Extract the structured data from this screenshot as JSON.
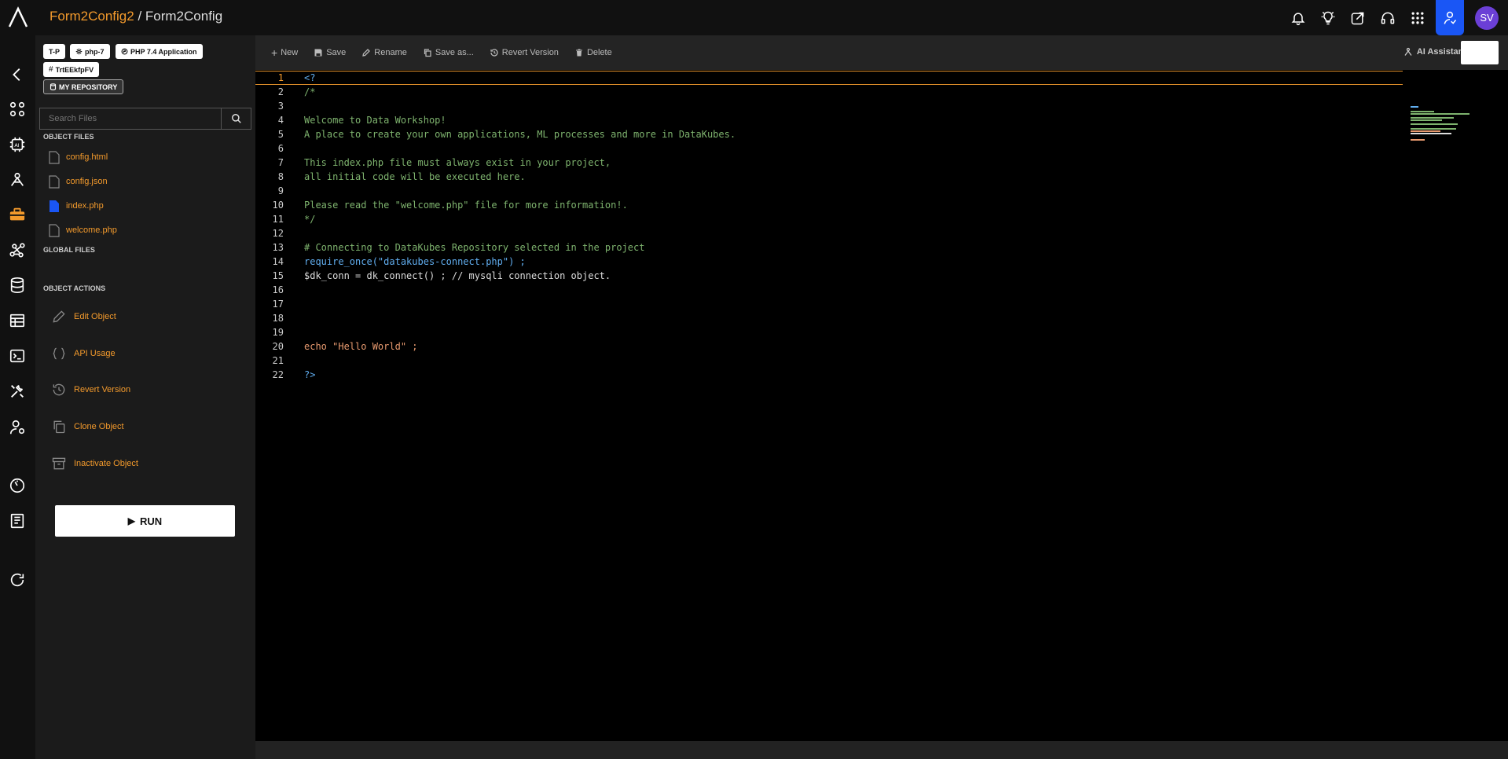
{
  "breadcrumb": {
    "parent": "Form2Config2",
    "separator": " / ",
    "current": "Form2Config"
  },
  "user": {
    "initials": "SV"
  },
  "tags": [
    {
      "label": "T-P",
      "icon": ""
    },
    {
      "label": "php-7",
      "icon": "gear-icon"
    },
    {
      "label": "PHP 7.4 Application",
      "icon": "php-icon"
    },
    {
      "label": "TrtEEkfpFV",
      "icon": "hash-icon"
    }
  ],
  "repo_tag": "MY REPOSITORY",
  "search": {
    "placeholder": "Search Files"
  },
  "sections": {
    "object_files": "OBJECT FILES",
    "global_files": "GLOBAL FILES",
    "object_actions": "OBJECT ACTIONS"
  },
  "files": [
    {
      "name": "config.html",
      "active": false
    },
    {
      "name": "config.json",
      "active": false
    },
    {
      "name": "index.php",
      "active": true
    },
    {
      "name": "welcome.php",
      "active": false
    }
  ],
  "actions": [
    {
      "label": "Edit Object",
      "icon": "pencil-icon"
    },
    {
      "label": "API Usage",
      "icon": "braces-icon"
    },
    {
      "label": "Revert Version",
      "icon": "history-icon"
    },
    {
      "label": "Clone Object",
      "icon": "clone-icon"
    },
    {
      "label": "Inactivate Object",
      "icon": "archive-icon"
    }
  ],
  "run_label": "RUN",
  "toolbar": {
    "new": "New",
    "save": "Save",
    "rename": "Rename",
    "save_as": "Save as...",
    "revert": "Revert Version",
    "delete": "Delete",
    "ai": "AI Assistant"
  },
  "code_lines": [
    "<?",
    "/*",
    "",
    "Welcome to Data Workshop!",
    "A place to create your own applications, ML processes and more in DataKubes.",
    "",
    "This index.php file must always exist in your project,",
    "all initial code will be executed here.",
    "",
    "Please read the \"welcome.php\" file for more information!.",
    "*/",
    "",
    "# Connecting to DataKubes Repository selected in the project",
    "require_once(\"datakubes-connect.php\") ;",
    "$dk_conn = dk_connect() ; // mysqli connection object.",
    "",
    "",
    "",
    "",
    "echo \"Hello World\" ;",
    "",
    "?>"
  ],
  "colors": {
    "accent": "#f39a2c",
    "active_blue": "#1a56f5",
    "avatar": "#6b3fd6"
  }
}
